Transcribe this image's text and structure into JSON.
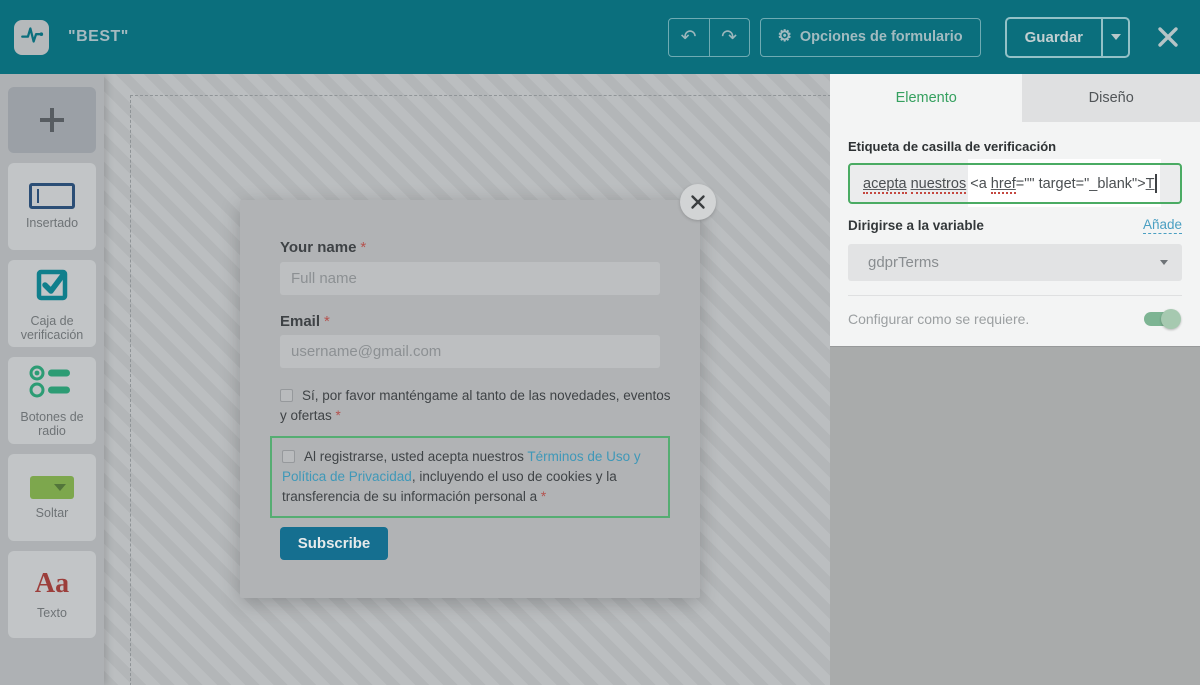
{
  "header": {
    "title": "\"BEST\"",
    "undo_icon": "↶",
    "redo_icon": "↷",
    "gear_icon": "⚙",
    "form_options_label": "Opciones de formulario",
    "save_label": "Guardar"
  },
  "sidebar": {
    "add_label": "",
    "insertado_label": "Insertado",
    "caja_label_line1": "Caja de",
    "caja_label_line2": "verificación",
    "radio_label_line1": "Botones de",
    "radio_label_line2": "radio",
    "soltar_label": "Soltar",
    "texto_label": "Texto",
    "texto_icon_text": "Aa"
  },
  "form_preview": {
    "name_label": "Your name",
    "name_required": "*",
    "name_placeholder": "Full name",
    "email_label": "Email",
    "email_required": "*",
    "email_placeholder": "username@gmail.com",
    "checkbox_news_text": "Sí, por favor manténgame al tanto de las novedades, eventos y ofertas ",
    "checkbox_news_required": "*",
    "checkbox_gdpr_part1": "Al registrarse, usted acepta nuestros ",
    "checkbox_gdpr_link": "Términos de Uso y Política de Privacidad",
    "checkbox_gdpr_part2": ", incluyendo el uso de cookies y la transferencia de su información personal a ",
    "checkbox_gdpr_required": " *",
    "submit_label": "Subscribe"
  },
  "panel": {
    "tab_element": "Elemento",
    "tab_design": "Diseño",
    "checkbox_label_title": "Etiqueta de casilla de verificación",
    "label_input": {
      "word1": "acepta",
      "space1": " ",
      "word2": "nuestros",
      "code_open": " <a ",
      "attr_href": "href",
      "code_mid": "=\"\" target=\"_blank\">",
      "typed_char": "T"
    },
    "variable_title": "Dirigirse a la variable",
    "add_link_label": "Añade",
    "variable_value": "gdprTerms",
    "required_toggle_label": "Configurar como se requiere.",
    "toggle_state": "on"
  },
  "colors": {
    "header_teal": "#0b6f7d",
    "highlight_green_border": "#4aab63",
    "selection_green_border": "#55ad72",
    "link_blue": "#3f98b8",
    "toggle_green": "#7db493",
    "submit_teal": "#156f90",
    "texto_red": "#9c3e3b"
  }
}
